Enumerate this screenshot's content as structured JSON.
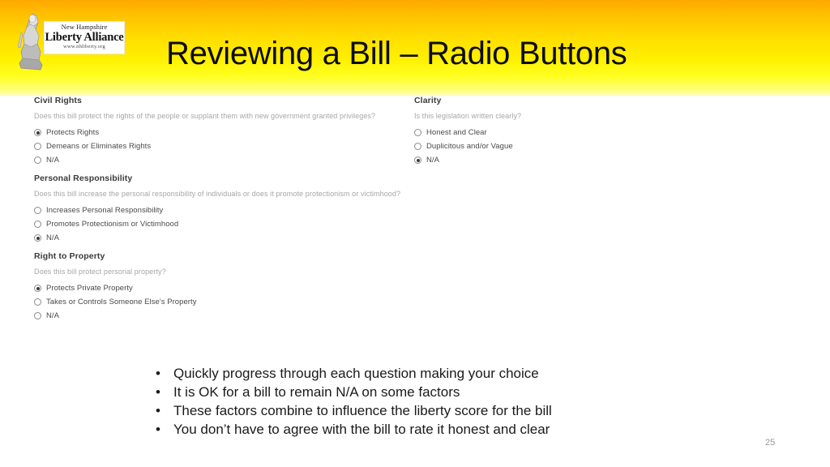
{
  "slide": {
    "title": "Reviewing a Bill – Radio Buttons",
    "page_number": "25",
    "accent_top": "#FFA800",
    "accent_bottom": "#FFFF22"
  },
  "logo": {
    "alt": "New Hampshire Liberty Alliance",
    "line1": "New Hampshire",
    "line2": "Liberty Alliance",
    "line3": "www.nhliberty.org"
  },
  "form": {
    "left_column": [
      {
        "heading": "Civil Rights",
        "question": "Does this bill protect the rights of the people or supplant them with new government granted privileges?",
        "options": [
          {
            "label": "Protects Rights",
            "selected": true
          },
          {
            "label": "Demeans or Eliminates Rights",
            "selected": false
          },
          {
            "label": "N/A",
            "selected": false
          }
        ]
      },
      {
        "heading": "Personal Responsibility",
        "question": "Does this bill increase the personal responsibility of individuals or does it promote protectionism or victimhood?",
        "options": [
          {
            "label": "Increases Personal Responsibility",
            "selected": false
          },
          {
            "label": "Promotes Protectionism or Victimhood",
            "selected": false
          },
          {
            "label": "N/A",
            "selected": true
          }
        ]
      },
      {
        "heading": "Right to Property",
        "question": "Does this bill protect personal property?",
        "options": [
          {
            "label": "Protects Private Property",
            "selected": true
          },
          {
            "label": "Takes or Controls Someone Else's Property",
            "selected": false
          },
          {
            "label": "N/A",
            "selected": false
          }
        ]
      }
    ],
    "right_column": [
      {
        "heading": "Clarity",
        "question": "Is this legislation written clearly?",
        "options": [
          {
            "label": "Honest and Clear",
            "selected": false
          },
          {
            "label": "Duplicitous and/or Vague",
            "selected": false
          },
          {
            "label": "N/A",
            "selected": true
          }
        ]
      }
    ]
  },
  "bullets": [
    "Quickly progress through each question making your choice",
    "It is OK for a bill to remain N/A on some factors",
    "These factors combine to influence the liberty score for the bill",
    "You don’t have to agree with the bill to rate it honest and clear"
  ],
  "bullet_marker": "•"
}
